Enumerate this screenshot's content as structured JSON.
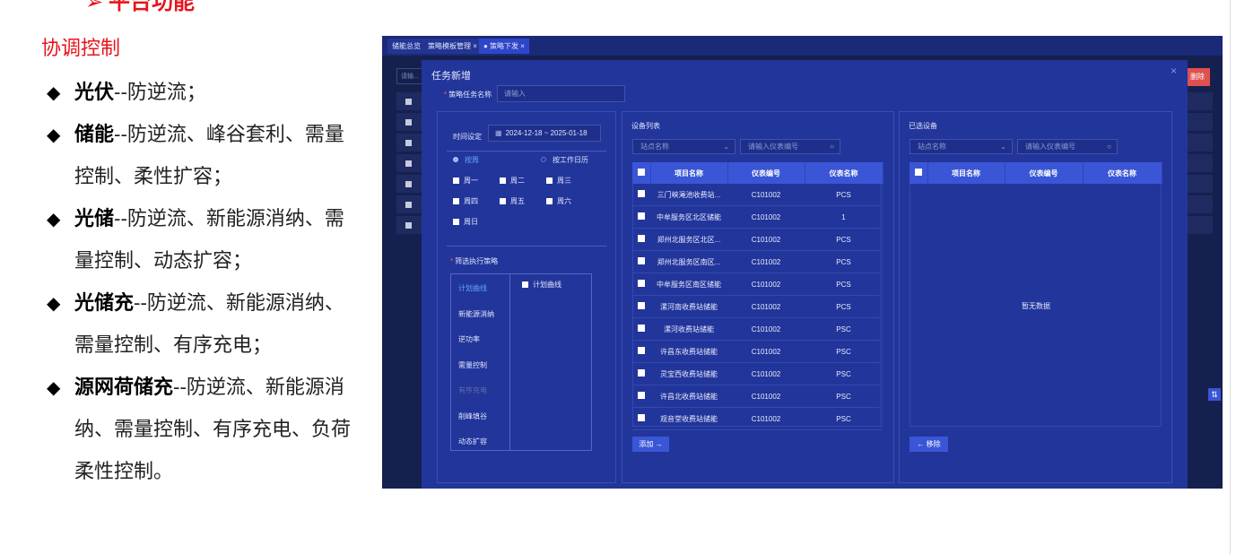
{
  "document": {
    "section_heading": "平台功能",
    "subheading": "协调控制",
    "bullets": [
      {
        "label": "光伏",
        "text": "--防逆流；"
      },
      {
        "label": "储能",
        "text": "--防逆流、峰谷套利、需量控制、柔性扩容；"
      },
      {
        "label": "光储",
        "text": "--防逆流、新能源消纳、需量控制、动态扩容；"
      },
      {
        "label": "光储充",
        "text": "--防逆流、新能源消纳、需量控制、有序充电；"
      },
      {
        "label": "源网荷储充",
        "text": "--防逆流、新能源消纳、需量控制、有序充电、负荷柔性控制。"
      }
    ]
  },
  "screenshot": {
    "tabs": [
      {
        "label": "储能总览"
      },
      {
        "label": "策略模板管理 ×"
      },
      {
        "label": "● 策略下发 ×"
      }
    ],
    "background": {
      "search_placeholder": "请输...",
      "delete_label": "删除"
    },
    "modal": {
      "title": "任务新增",
      "close": "×",
      "task_name_label": "策略任务名称",
      "task_name_placeholder": "请输入",
      "time_label": "时间设定",
      "date_range": "2024-12-18 ~ 2025-01-18",
      "mode_options": [
        "按周",
        "按工作日历"
      ],
      "weekdays": [
        "周一",
        "周二",
        "周三",
        "周四",
        "周五",
        "周六",
        "周日"
      ],
      "strategy_label": "筛选执行策略",
      "strategies": [
        {
          "label": "计划曲线",
          "state": "active"
        },
        {
          "label": "新能源消纳",
          "state": "normal"
        },
        {
          "label": "逆功率",
          "state": "normal"
        },
        {
          "label": "需量控制",
          "state": "normal"
        },
        {
          "label": "有序充电",
          "state": "disabled"
        },
        {
          "label": "削峰填谷",
          "state": "normal"
        },
        {
          "label": "动态扩容",
          "state": "normal"
        }
      ],
      "strategy_option": "计划曲线",
      "device_list": {
        "title": "设备列表",
        "station_select": "站点名称",
        "meter_search": "请输入仪表编号",
        "columns": [
          "项目名称",
          "仪表编号",
          "仪表名称"
        ],
        "rows": [
          [
            "三门峡渑池收费站...",
            "C101002",
            "PCS"
          ],
          [
            "中牟服务区北区储能",
            "C101002",
            "1"
          ],
          [
            "郑州北服务区北区...",
            "C101002",
            "PCS"
          ],
          [
            "郑州北服务区南区...",
            "C101002",
            "PCS"
          ],
          [
            "中牟服务区南区储能",
            "C101002",
            "PCS"
          ],
          [
            "漯河南收费站储能",
            "C101002",
            "PCS"
          ],
          [
            "漯河收费站储能",
            "C101002",
            "PSC"
          ],
          [
            "许昌东收费站储能",
            "C101002",
            "PSC"
          ],
          [
            "灵宝西收费站储能",
            "C101002",
            "PSC"
          ],
          [
            "许昌北收费站储能",
            "C101002",
            "PSC"
          ],
          [
            "观音堂收费站储能",
            "C101002",
            "PSC"
          ]
        ],
        "add_button": "添加 →"
      },
      "selected": {
        "title": "已选设备",
        "station_select": "站点名称",
        "meter_search": "请输入仪表编号",
        "columns": [
          "项目名称",
          "仪表编号",
          "仪表名称"
        ],
        "empty": "暂无数据",
        "remove_button": "← 移除"
      }
    }
  }
}
